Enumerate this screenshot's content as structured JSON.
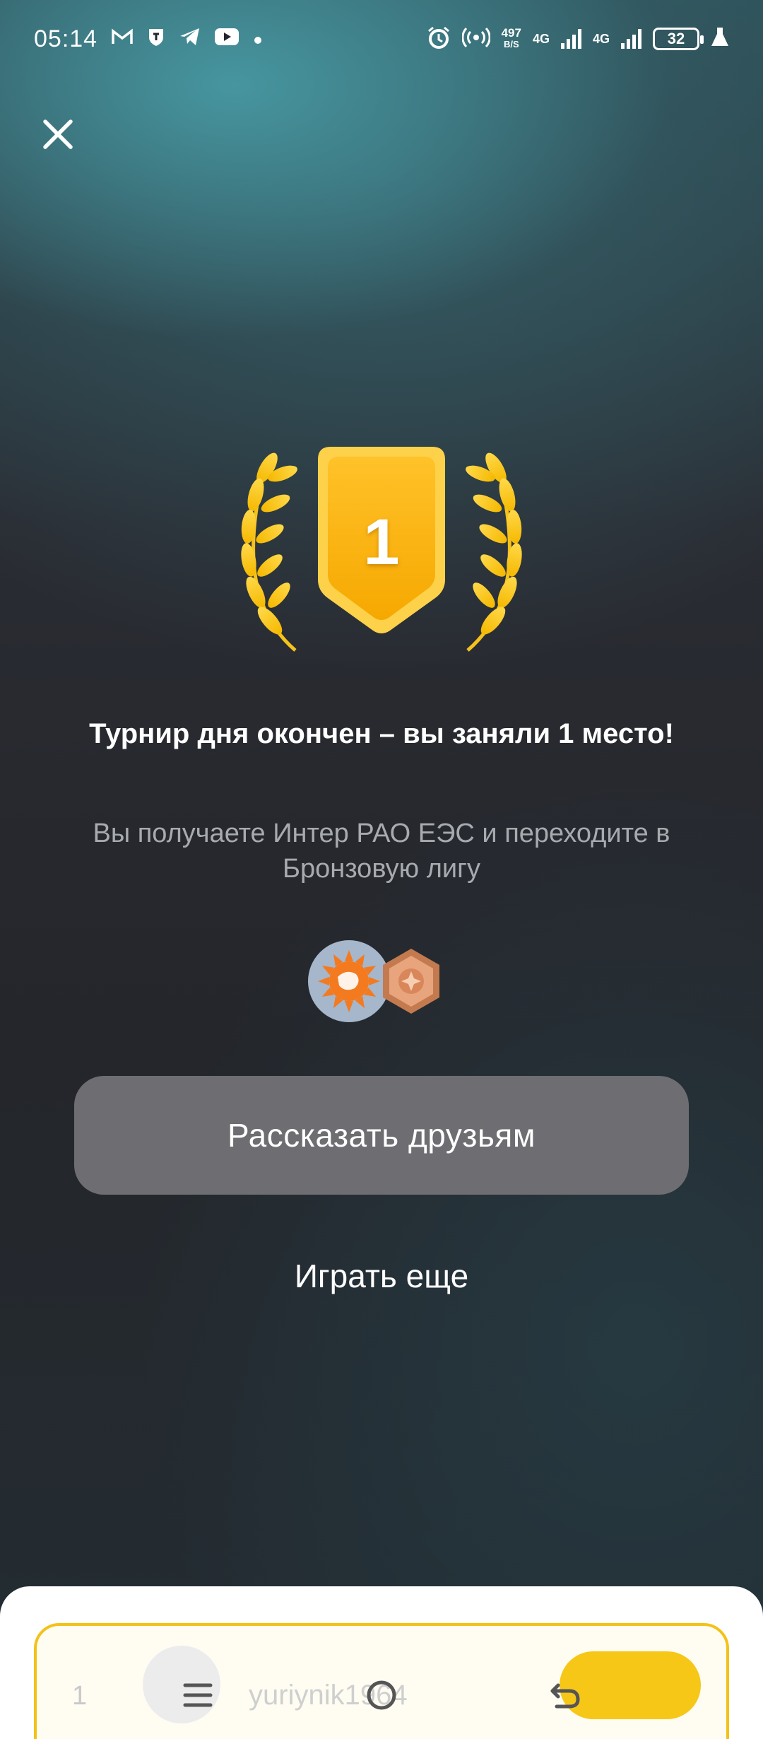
{
  "status_bar": {
    "time": "05:14",
    "net_speed_value": "497",
    "net_speed_unit": "B/S",
    "network_1": "4G",
    "network_2": "4G",
    "battery": "32",
    "notification_icons": [
      "gmail-icon",
      "shield-app-icon",
      "telegram-icon",
      "youtube-icon",
      "dot-icon"
    ],
    "system_icons": [
      "alarm-icon",
      "hotspot-icon",
      "signal-icon",
      "signal-icon",
      "battery-icon",
      "flask-icon"
    ]
  },
  "trophy": {
    "place": "1"
  },
  "result": {
    "headline": "Турнир дня окончен – вы заняли 1 место!",
    "subtext": "Вы получаете Интер РАО ЕЭС и переходите в Бронзовую лигу"
  },
  "rewards": [
    "inter-rao-logo",
    "bronze-league-badge"
  ],
  "actions": {
    "share_label": "Рассказать друзьям",
    "play_again_label": "Играть еще"
  },
  "leaderboard_row": {
    "rank": "1",
    "username": "yuriynik1964"
  },
  "colors": {
    "gold": "#f6b90e",
    "bronze": "#c47a4f",
    "button_gray": "#6d6d72",
    "row_border": "#f3c21a"
  }
}
